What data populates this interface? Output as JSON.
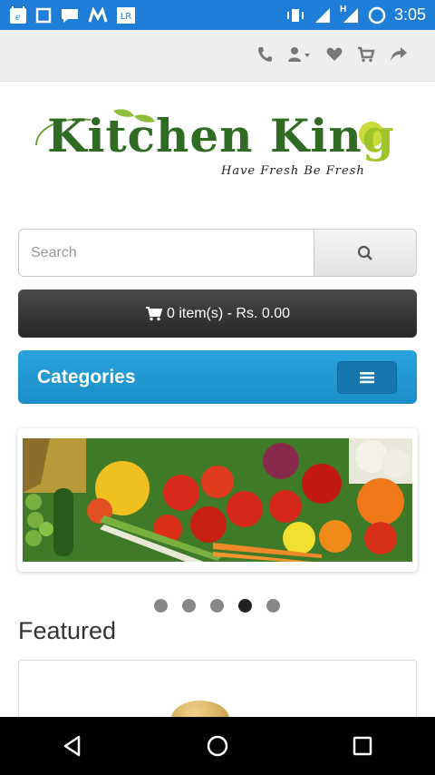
{
  "status_bar": {
    "time": "3:05",
    "network_label": "H",
    "left_icons": [
      "browser-icon",
      "square-icon",
      "message-icon",
      "m-icon",
      "lr-icon"
    ],
    "right_icons": [
      "vibrate-icon",
      "signal-icon",
      "data-signal-icon",
      "battery-ring-icon"
    ]
  },
  "top_nav": {
    "icons": [
      "phone-icon",
      "user-icon",
      "heart-icon",
      "cart-icon",
      "share-icon"
    ]
  },
  "logo": {
    "title_part1": "Kitchen Kin",
    "title_part2": "g",
    "tagline": "Have Fresh Be Fresh"
  },
  "search": {
    "placeholder": "Search",
    "value": ""
  },
  "cart": {
    "label": "0 item(s) - Rs. 0.00"
  },
  "categories": {
    "title": "Categories"
  },
  "slider": {
    "dot_count": 5,
    "active_index": 3
  },
  "featured": {
    "heading": "Featured"
  },
  "colors": {
    "status_bar": "#1e7dd6",
    "categories_bar": "#1b8ec7",
    "cart_bar": "#2f2f2f",
    "logo_green": "#2f6b22"
  }
}
